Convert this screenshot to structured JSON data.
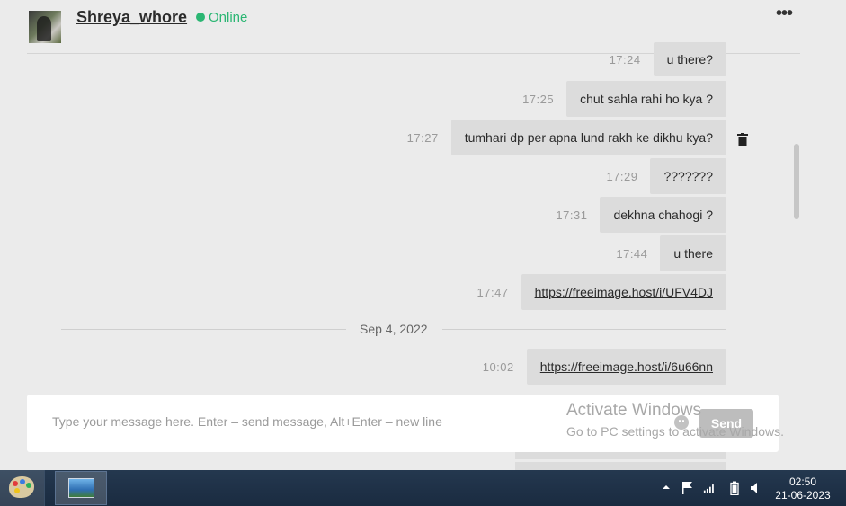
{
  "header": {
    "username": "Shreya_whore",
    "status": "Online",
    "more_icon": "more-horizontal-icon"
  },
  "messages": [
    {
      "time": "17:24",
      "text": "u there?"
    },
    {
      "time": "17:25",
      "text": "chut sahla rahi ho kya ?"
    },
    {
      "time": "17:27",
      "text": "tumhari dp per apna lund rakh ke dikhu kya?"
    },
    {
      "time": "17:29",
      "text": "???????"
    },
    {
      "time": "17:31",
      "text": "dekhna chahogi ?"
    },
    {
      "time": "17:44",
      "text": "u there"
    },
    {
      "time": "17:47",
      "text": "https://freeimage.host/i/UFV4DJ"
    },
    {
      "time": "10:02",
      "text": "https://freeimage.host/i/6u66nn"
    }
  ],
  "date_separator": "Sep 4, 2022",
  "composer": {
    "placeholder": "Type your message here. Enter – send message, Alt+Enter – new line",
    "value": "",
    "send_label": "Send",
    "emoji_icon": "smiley-icon"
  },
  "watermark": {
    "line1": "Activate Windows",
    "line2": "Go to PC settings to activate Windows."
  },
  "taskbar": {
    "time": "02:50",
    "date": "21-06-2023",
    "tray_icons": [
      "chevron-up-icon",
      "flag-icon",
      "signal-icon",
      "battery-icon",
      "volume-icon"
    ]
  },
  "colors": {
    "background": "#ebebeb",
    "bubble": "#dcdcdc",
    "online": "#2bb673",
    "taskbar": "#1f3146"
  }
}
